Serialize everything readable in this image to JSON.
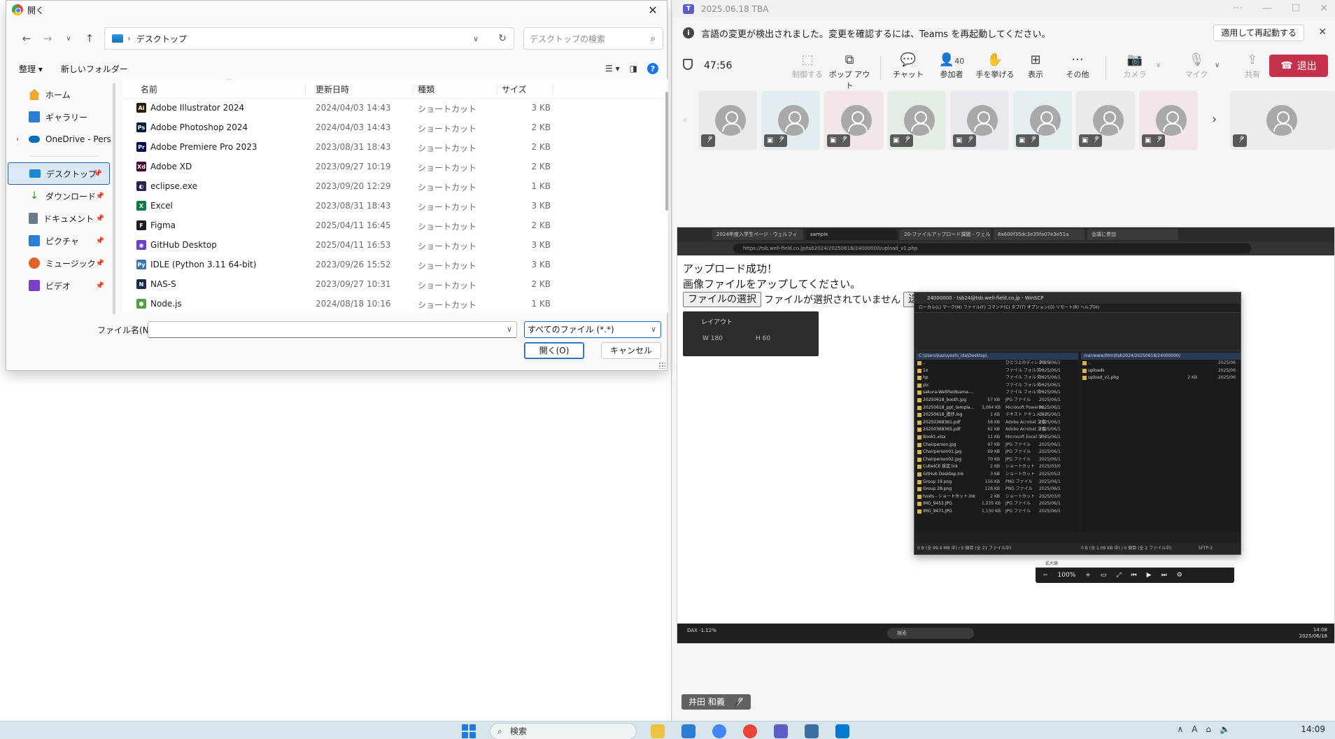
{
  "dialog": {
    "title": "開く",
    "path": "デスクトップ",
    "search_placeholder": "デスクトップの検索",
    "organize": "整理 ▾",
    "new_folder": "新しいフォルダー",
    "nav": {
      "home": "ホーム",
      "gallery": "ギャラリー",
      "onedrive": "OneDrive - Persi",
      "desktop": "デスクトップ",
      "downloads": "ダウンロード",
      "documents": "ドキュメント",
      "pictures": "ピクチャ",
      "music": "ミュージック",
      "videos": "ビデオ"
    },
    "columns": {
      "name": "名前",
      "date": "更新日時",
      "type": "種類",
      "size": "サイズ"
    },
    "files": [
      {
        "name": "Adobe Illustrator 2024",
        "date": "2024/04/03 14:43",
        "type": "ショートカット",
        "size": "3 KB",
        "icon": "illustrator-icon",
        "color": "#2f1c00",
        "glyph": "Ai"
      },
      {
        "name": "Adobe Photoshop 2024",
        "date": "2024/04/03 14:43",
        "type": "ショートカット",
        "size": "2 KB",
        "icon": "photoshop-icon",
        "color": "#001e36",
        "glyph": "Ps"
      },
      {
        "name": "Adobe Premiere Pro 2023",
        "date": "2023/08/31 18:43",
        "type": "ショートカット",
        "size": "2 KB",
        "icon": "premiere-icon",
        "color": "#00005b",
        "glyph": "Pr"
      },
      {
        "name": "Adobe XD",
        "date": "2023/09/27 10:19",
        "type": "ショートカット",
        "size": "2 KB",
        "icon": "xd-icon",
        "color": "#470137",
        "glyph": "Xd"
      },
      {
        "name": "eclipse.exe",
        "date": "2023/09/20 12:29",
        "type": "ショートカット",
        "size": "1 KB",
        "icon": "eclipse-icon",
        "color": "#2c2255",
        "glyph": "◐"
      },
      {
        "name": "Excel",
        "date": "2023/08/31 18:43",
        "type": "ショートカット",
        "size": "3 KB",
        "icon": "excel-icon",
        "color": "#107c41",
        "glyph": "X"
      },
      {
        "name": "Figma",
        "date": "2025/04/11 16:45",
        "type": "ショートカット",
        "size": "2 KB",
        "icon": "figma-icon",
        "color": "#1e1e1e",
        "glyph": "F"
      },
      {
        "name": "GitHub Desktop",
        "date": "2025/04/11 16:53",
        "type": "ショートカット",
        "size": "3 KB",
        "icon": "github-icon",
        "color": "#6e40c9",
        "glyph": "◉"
      },
      {
        "name": "IDLE (Python 3.11 64-bit)",
        "date": "2023/09/26 15:52",
        "type": "ショートカット",
        "size": "3 KB",
        "icon": "python-icon",
        "color": "#3776ab",
        "glyph": "Py"
      },
      {
        "name": "NAS-S",
        "date": "2023/09/27 10:31",
        "type": "ショートカット",
        "size": "2 KB",
        "icon": "nas-icon",
        "color": "#1a2a4a",
        "glyph": "N"
      },
      {
        "name": "Node.js",
        "date": "2024/08/18 10:16",
        "type": "ショートカット",
        "size": "1 KB",
        "icon": "nodejs-icon",
        "color": "#539e43",
        "glyph": "⬢"
      }
    ],
    "filename_label": "ファイル名(N):",
    "filetype": "すべてのファイル (*.*)",
    "open_button": "開く(O)",
    "cancel_button": "キャンセル"
  },
  "teams": {
    "title": "2025.06.18 TBA",
    "notice": "言語の変更が検出されました。変更を確認するには、Teams を再起動してください。",
    "notice_button": "適用して再起動する",
    "timer": "47:56",
    "toolbar": {
      "control": "制御する",
      "popout": "ポップ アウト",
      "chat": "チャット",
      "participants": "参加者",
      "participants_count": "40",
      "raise_hand": "手を挙げる",
      "view": "表示",
      "more": "その他",
      "camera": "カメラ",
      "mic": "マイク",
      "share": "共有",
      "leave": "退出"
    },
    "presenter_name": "井田 和義"
  },
  "shared_screen": {
    "tabs": [
      "2024年度入学生ページ - ウェルフィ",
      "sample",
      "20-ファイルアップロード課題 - ウェル",
      "8a600f35dc3e35fa07e3e51a",
      "会議に参加"
    ],
    "url": "https://tsb.well-field.co.jp/tsb2024/20250618/24000000/upload_v1.php",
    "heading1": "アップロード成功！",
    "heading2": "画像ファイルをアップしてください。",
    "choose_file": "ファイルの選択",
    "no_file": "ファイルが選択されていません",
    "submit": "送信",
    "layout_title": "レイアウト",
    "layout_w": "W  180",
    "layout_h": "H  60",
    "winscp_title": "24000000 - tsb24@tsb.well-field.co.jp - WinSCP",
    "winscp_menu": "ローカル(L)  マーク(M)  ファイル(F)  コマンド(C)  タブ(T)  オプション(O)  リモート(R)  ヘルプ(H)",
    "local_path": "C:\\Users\\kazuyoshi_ida\\Desktop\\",
    "remote_path": "/var/www/html/tsb2024/20250618/24000000/",
    "local_files": [
      {
        "n": "..",
        "s": "",
        "t": "ひとつ上のディレクトリ",
        "d": "2025/06/1"
      },
      {
        "n": "1x",
        "s": "",
        "t": "ファイル フォルダー",
        "d": "2025/06/1"
      },
      {
        "n": "hp",
        "s": "",
        "t": "ファイル フォルダー",
        "d": "2025/06/1"
      },
      {
        "n": "pic",
        "s": "",
        "t": "ファイル フォルダー",
        "d": "2025/06/1"
      },
      {
        "n": "sakura-WellFieldsama-...",
        "s": "",
        "t": "ファイル フォルダー",
        "d": "2025/06/1"
      },
      {
        "n": "20250618_booth.jpg",
        "s": "57 KB",
        "t": "JPG ファイル",
        "d": "2025/06/1"
      },
      {
        "n": "20250618_ppt_templa...",
        "s": "3,084 KB",
        "t": "Microsoft PowerPo...",
        "d": "2025/06/1"
      },
      {
        "n": "20250618_進捗.log",
        "s": "1 KB",
        "t": "テキスト ドキュメント",
        "d": "2025/06/1"
      },
      {
        "n": "20250368361.pdf",
        "s": "58 KB",
        "t": "Adobe Acrobat 文書",
        "d": "2025/06/1"
      },
      {
        "n": "20250368365.pdf",
        "s": "62 KB",
        "t": "Adobe Acrobat 文書",
        "d": "2025/06/1"
      },
      {
        "n": "Book1.xlsx",
        "s": "11 KB",
        "t": "Microsoft Excel ワー...",
        "d": "2025/06/1"
      },
      {
        "n": "Chairperson.jpg",
        "s": "97 KB",
        "t": "JPG ファイル",
        "d": "2025/06/1"
      },
      {
        "n": "Chairperson01.jpg",
        "s": "69 KB",
        "t": "JPG ファイル",
        "d": "2025/06/1"
      },
      {
        "n": "Chairperson02.jpg",
        "s": "70 KB",
        "t": "JPG ファイル",
        "d": "2025/06/1"
      },
      {
        "n": "CubeICE 設定.lnk",
        "s": "2 KB",
        "t": "ショートカット",
        "d": "2025/03/0"
      },
      {
        "n": "GitHub Desktop.lnk",
        "s": "3 KB",
        "t": "ショートカット",
        "d": "2025/05/2"
      },
      {
        "n": "Group 19.png",
        "s": "156 KB",
        "t": "PNG ファイル",
        "d": "2025/06/1"
      },
      {
        "n": "Group 28.png",
        "s": "128 KB",
        "t": "PNG ファイル",
        "d": "2025/06/1"
      },
      {
        "n": "hosts - ショートカット.lnk",
        "s": "2 KB",
        "t": "ショートカット",
        "d": "2025/03/0"
      },
      {
        "n": "IMG_9453.JPG",
        "s": "1,235 KB",
        "t": "JPG ファイル",
        "d": "2025/06/1"
      },
      {
        "n": "IMG_9471.JPG",
        "s": "1,130 KB",
        "t": "JPG ファイル",
        "d": "2025/06/1"
      }
    ],
    "remote_files": [
      {
        "n": "..",
        "s": "",
        "d": "2025/06"
      },
      {
        "n": "uploads",
        "s": "",
        "d": "2025/06"
      },
      {
        "n": "upload_v1.php",
        "s": "2 KB",
        "d": "2025/06"
      }
    ],
    "status_left": "0 B (全 99.4 MB 中) / 0 個目 (全 21 ファイル中)",
    "status_right": "0 B (全 1.09 KB 中) / 0 個目 (全 2 ファイル中)",
    "status_protocol": "SFTP-3",
    "zoom_title": "拡大鏡",
    "zoom_level": "100%",
    "taskbar_stock": "DAX  -1.12%",
    "taskbar_search": "検索",
    "taskbar_time": "14:08",
    "taskbar_date": "2025/06/18"
  },
  "os": {
    "search": "検索",
    "clock": "14:09"
  }
}
